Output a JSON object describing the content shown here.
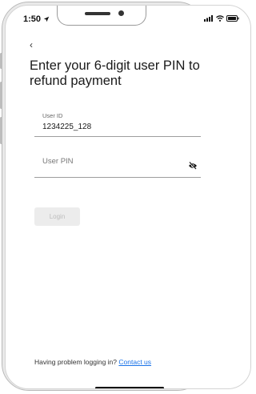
{
  "status_bar": {
    "time": "1:50",
    "location_icon": "location-arrow-icon",
    "signal_icon": "cellular-signal-icon",
    "wifi_icon": "wifi-icon",
    "battery_icon": "battery-icon"
  },
  "nav": {
    "back_label": "‹"
  },
  "page": {
    "title": "Enter your 6-digit user PIN to refund payment"
  },
  "form": {
    "user_id": {
      "label": "User ID",
      "value": "1234225_128"
    },
    "user_pin": {
      "placeholder": "User PIN",
      "toggle_icon": "eye-off-icon"
    },
    "login_label": "Login"
  },
  "footer": {
    "help_text": "Having problem logging in?",
    "contact_link": "Contact us"
  },
  "colors": {
    "link": "#1a73e8",
    "disabled_button_bg": "#ececec",
    "disabled_button_text": "#bdbdbd"
  }
}
